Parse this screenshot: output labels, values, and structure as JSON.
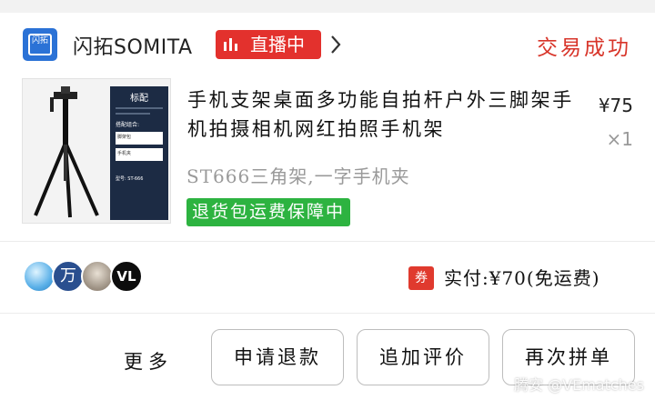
{
  "shop": {
    "logo_text": "闪拓",
    "name": "闪拓SOMITA",
    "live_label": "直播中",
    "status": "交易成功"
  },
  "product": {
    "title": "手机支架桌面多功能自拍杆户外三脚架手机拍摄相机网红拍照手机架",
    "price": "¥75",
    "quantity": "×1",
    "sku": "ST666三角架,一字手机夹",
    "guarantee": "退货包运费保障中",
    "thumbnail": {
      "panel_title": "标配",
      "panel_subtitle": "搭配组合:",
      "item1": "脚架包",
      "item2": "手机夹",
      "model": "型号: ST-666"
    }
  },
  "payment": {
    "avatars": [
      {
        "icon": "globe-avatar",
        "text": ""
      },
      {
        "icon": "text-avatar",
        "text": "万"
      },
      {
        "icon": "person-avatar",
        "text": ""
      },
      {
        "icon": "logo-avatar",
        "text": "VL"
      }
    ],
    "coupon_label": "券",
    "paid_text": "实付:¥70(免运费)"
  },
  "actions": {
    "more_label": "更多",
    "refund_label": "申请退款",
    "review_label": "追加评价",
    "regroup_label": "再次拼单"
  },
  "watermark": "腾安 @VEmatches",
  "colors": {
    "live_red": "#e3312d",
    "status_red": "#d8352a",
    "guarantee_green": "#2db340",
    "logo_blue": "#2b72d6"
  }
}
